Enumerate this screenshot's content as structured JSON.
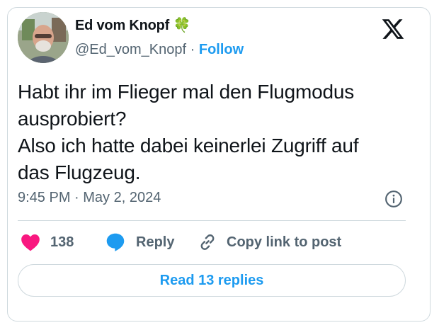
{
  "author": {
    "name": "Ed vom Knopf 🍀",
    "handle": "@Ed_vom_Knopf",
    "separator": "·",
    "follow_label": "Follow"
  },
  "tweet": {
    "lines": [
      "Habt ihr im Flieger mal den Flugmodus",
      "ausprobiert?",
      "Also ich hatte dabei keinerlei Zugriff auf",
      "das Flugzeug."
    ],
    "timestamp": "9:45 PM · May 2, 2024"
  },
  "actions": {
    "like_count": "138",
    "reply_label": "Reply",
    "copy_label": "Copy link to post"
  },
  "read_replies_label": "Read 13 replies",
  "icons": {
    "logo": "x-logo-icon",
    "info": "info-icon",
    "like": "heart-icon",
    "reply": "speech-bubble-icon",
    "copy": "link-icon"
  },
  "colors": {
    "accent": "#1d9bf0",
    "like": "#f91880",
    "muted": "#536471",
    "text": "#0f1419",
    "border": "#cfd9de"
  }
}
